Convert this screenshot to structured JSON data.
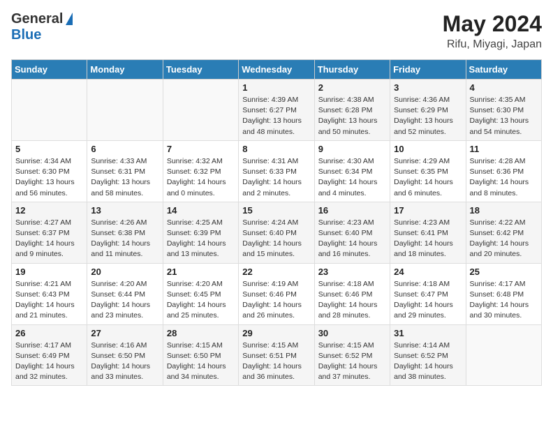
{
  "header": {
    "logo_general": "General",
    "logo_blue": "Blue",
    "month": "May 2024",
    "location": "Rifu, Miyagi, Japan"
  },
  "days_of_week": [
    "Sunday",
    "Monday",
    "Tuesday",
    "Wednesday",
    "Thursday",
    "Friday",
    "Saturday"
  ],
  "weeks": [
    [
      {
        "day": "",
        "info": ""
      },
      {
        "day": "",
        "info": ""
      },
      {
        "day": "",
        "info": ""
      },
      {
        "day": "1",
        "info": "Sunrise: 4:39 AM\nSunset: 6:27 PM\nDaylight: 13 hours\nand 48 minutes."
      },
      {
        "day": "2",
        "info": "Sunrise: 4:38 AM\nSunset: 6:28 PM\nDaylight: 13 hours\nand 50 minutes."
      },
      {
        "day": "3",
        "info": "Sunrise: 4:36 AM\nSunset: 6:29 PM\nDaylight: 13 hours\nand 52 minutes."
      },
      {
        "day": "4",
        "info": "Sunrise: 4:35 AM\nSunset: 6:30 PM\nDaylight: 13 hours\nand 54 minutes."
      }
    ],
    [
      {
        "day": "5",
        "info": "Sunrise: 4:34 AM\nSunset: 6:30 PM\nDaylight: 13 hours\nand 56 minutes."
      },
      {
        "day": "6",
        "info": "Sunrise: 4:33 AM\nSunset: 6:31 PM\nDaylight: 13 hours\nand 58 minutes."
      },
      {
        "day": "7",
        "info": "Sunrise: 4:32 AM\nSunset: 6:32 PM\nDaylight: 14 hours\nand 0 minutes."
      },
      {
        "day": "8",
        "info": "Sunrise: 4:31 AM\nSunset: 6:33 PM\nDaylight: 14 hours\nand 2 minutes."
      },
      {
        "day": "9",
        "info": "Sunrise: 4:30 AM\nSunset: 6:34 PM\nDaylight: 14 hours\nand 4 minutes."
      },
      {
        "day": "10",
        "info": "Sunrise: 4:29 AM\nSunset: 6:35 PM\nDaylight: 14 hours\nand 6 minutes."
      },
      {
        "day": "11",
        "info": "Sunrise: 4:28 AM\nSunset: 6:36 PM\nDaylight: 14 hours\nand 8 minutes."
      }
    ],
    [
      {
        "day": "12",
        "info": "Sunrise: 4:27 AM\nSunset: 6:37 PM\nDaylight: 14 hours\nand 9 minutes."
      },
      {
        "day": "13",
        "info": "Sunrise: 4:26 AM\nSunset: 6:38 PM\nDaylight: 14 hours\nand 11 minutes."
      },
      {
        "day": "14",
        "info": "Sunrise: 4:25 AM\nSunset: 6:39 PM\nDaylight: 14 hours\nand 13 minutes."
      },
      {
        "day": "15",
        "info": "Sunrise: 4:24 AM\nSunset: 6:40 PM\nDaylight: 14 hours\nand 15 minutes."
      },
      {
        "day": "16",
        "info": "Sunrise: 4:23 AM\nSunset: 6:40 PM\nDaylight: 14 hours\nand 16 minutes."
      },
      {
        "day": "17",
        "info": "Sunrise: 4:23 AM\nSunset: 6:41 PM\nDaylight: 14 hours\nand 18 minutes."
      },
      {
        "day": "18",
        "info": "Sunrise: 4:22 AM\nSunset: 6:42 PM\nDaylight: 14 hours\nand 20 minutes."
      }
    ],
    [
      {
        "day": "19",
        "info": "Sunrise: 4:21 AM\nSunset: 6:43 PM\nDaylight: 14 hours\nand 21 minutes."
      },
      {
        "day": "20",
        "info": "Sunrise: 4:20 AM\nSunset: 6:44 PM\nDaylight: 14 hours\nand 23 minutes."
      },
      {
        "day": "21",
        "info": "Sunrise: 4:20 AM\nSunset: 6:45 PM\nDaylight: 14 hours\nand 25 minutes."
      },
      {
        "day": "22",
        "info": "Sunrise: 4:19 AM\nSunset: 6:46 PM\nDaylight: 14 hours\nand 26 minutes."
      },
      {
        "day": "23",
        "info": "Sunrise: 4:18 AM\nSunset: 6:46 PM\nDaylight: 14 hours\nand 28 minutes."
      },
      {
        "day": "24",
        "info": "Sunrise: 4:18 AM\nSunset: 6:47 PM\nDaylight: 14 hours\nand 29 minutes."
      },
      {
        "day": "25",
        "info": "Sunrise: 4:17 AM\nSunset: 6:48 PM\nDaylight: 14 hours\nand 30 minutes."
      }
    ],
    [
      {
        "day": "26",
        "info": "Sunrise: 4:17 AM\nSunset: 6:49 PM\nDaylight: 14 hours\nand 32 minutes."
      },
      {
        "day": "27",
        "info": "Sunrise: 4:16 AM\nSunset: 6:50 PM\nDaylight: 14 hours\nand 33 minutes."
      },
      {
        "day": "28",
        "info": "Sunrise: 4:15 AM\nSunset: 6:50 PM\nDaylight: 14 hours\nand 34 minutes."
      },
      {
        "day": "29",
        "info": "Sunrise: 4:15 AM\nSunset: 6:51 PM\nDaylight: 14 hours\nand 36 minutes."
      },
      {
        "day": "30",
        "info": "Sunrise: 4:15 AM\nSunset: 6:52 PM\nDaylight: 14 hours\nand 37 minutes."
      },
      {
        "day": "31",
        "info": "Sunrise: 4:14 AM\nSunset: 6:52 PM\nDaylight: 14 hours\nand 38 minutes."
      },
      {
        "day": "",
        "info": ""
      }
    ]
  ]
}
